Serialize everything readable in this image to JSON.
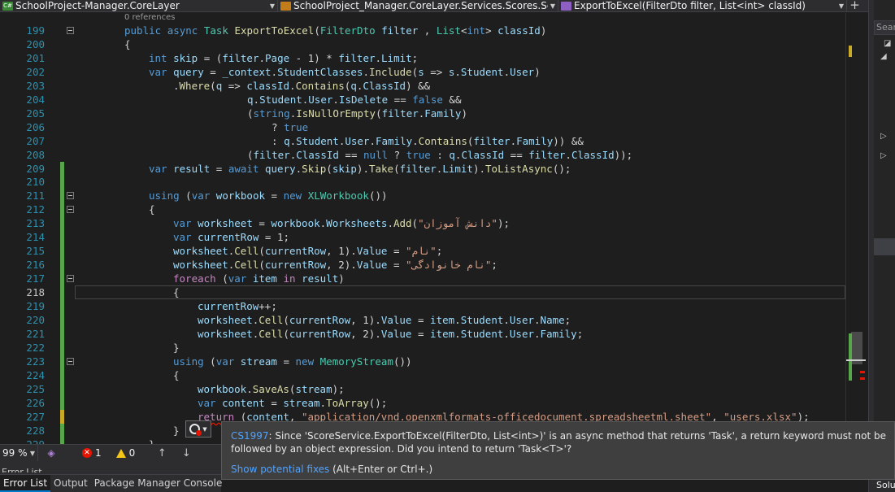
{
  "navbar": {
    "project": "SchoolProject-Manager.CoreLayer",
    "type_scope": "SchoolProject_Manager.CoreLayer.Services.Scores.ScoreServ",
    "member": "ExportToExcel(FilterDto filter, List<int> classId)",
    "project_badge": "C#",
    "add_symbol": "+"
  },
  "editor": {
    "codelens": "0 references",
    "lines": [
      {
        "n": "199",
        "seg": [
          [
            "k",
            "public "
          ],
          [
            "k",
            "async "
          ],
          [
            "t",
            "Task "
          ],
          [
            "m",
            "ExportToExcel"
          ],
          [
            "",
            "("
          ],
          [
            "t",
            "FilterDto "
          ],
          [
            "p",
            "filter"
          ],
          [
            "",
            " , "
          ],
          [
            "t",
            "List"
          ],
          [
            "",
            "<"
          ],
          [
            "k",
            "int"
          ],
          [
            "",
            "> "
          ],
          [
            "p",
            "classId"
          ],
          [
            "",
            ")"
          ]
        ]
      },
      {
        "n": "200",
        "seg": [
          [
            "",
            "{"
          ]
        ]
      },
      {
        "n": "201",
        "seg": [
          [
            "k",
            "int "
          ],
          [
            "p",
            "skip"
          ],
          [
            "",
            " = ("
          ],
          [
            "p",
            "filter"
          ],
          [
            "",
            "."
          ],
          [
            "p",
            "Page"
          ],
          [
            "",
            " - "
          ],
          [
            "",
            "1"
          ],
          [
            "",
            ") * "
          ],
          [
            "p",
            "filter"
          ],
          [
            "",
            "."
          ],
          [
            "p",
            "Limit"
          ],
          [
            "",
            ";"
          ]
        ]
      },
      {
        "n": "202",
        "seg": [
          [
            "k",
            "var "
          ],
          [
            "p",
            "query"
          ],
          [
            "",
            " = "
          ],
          [
            "p",
            "_context"
          ],
          [
            "",
            "."
          ],
          [
            "p",
            "StudentClasses"
          ],
          [
            "",
            "."
          ],
          [
            "m",
            "Include"
          ],
          [
            "",
            "("
          ],
          [
            "p",
            "s"
          ],
          [
            "",
            " => "
          ],
          [
            "p",
            "s"
          ],
          [
            "",
            "."
          ],
          [
            "p",
            "Student"
          ],
          [
            "",
            "."
          ],
          [
            "p",
            "User"
          ],
          [
            "",
            ")"
          ]
        ]
      },
      {
        "n": "203",
        "seg": [
          [
            "",
            "."
          ],
          [
            "m",
            "Where"
          ],
          [
            "",
            "("
          ],
          [
            "p",
            "q"
          ],
          [
            "",
            " => "
          ],
          [
            "p",
            "classId"
          ],
          [
            "",
            "."
          ],
          [
            "m",
            "Contains"
          ],
          [
            "",
            "("
          ],
          [
            "p",
            "q"
          ],
          [
            "",
            "."
          ],
          [
            "p",
            "ClassId"
          ],
          [
            "",
            ") &&"
          ]
        ]
      },
      {
        "n": "204",
        "seg": [
          [
            "p",
            "q"
          ],
          [
            "",
            "."
          ],
          [
            "p",
            "Student"
          ],
          [
            "",
            "."
          ],
          [
            "p",
            "User"
          ],
          [
            "",
            "."
          ],
          [
            "p",
            "IsDelete"
          ],
          [
            "",
            " == "
          ],
          [
            "k",
            "false"
          ],
          [
            "",
            " &&"
          ]
        ]
      },
      {
        "n": "205",
        "seg": [
          [
            "",
            "("
          ],
          [
            "k",
            "string"
          ],
          [
            "",
            "."
          ],
          [
            "m",
            "IsNullOrEmpty"
          ],
          [
            "",
            "("
          ],
          [
            "p",
            "filter"
          ],
          [
            "",
            "."
          ],
          [
            "p",
            "Family"
          ],
          [
            "",
            ")"
          ]
        ]
      },
      {
        "n": "206",
        "seg": [
          [
            "",
            "? "
          ],
          [
            "k",
            "true"
          ]
        ]
      },
      {
        "n": "207",
        "seg": [
          [
            "",
            ": "
          ],
          [
            "p",
            "q"
          ],
          [
            "",
            "."
          ],
          [
            "p",
            "Student"
          ],
          [
            "",
            "."
          ],
          [
            "p",
            "User"
          ],
          [
            "",
            "."
          ],
          [
            "p",
            "Family"
          ],
          [
            "",
            "."
          ],
          [
            "m",
            "Contains"
          ],
          [
            "",
            "("
          ],
          [
            "p",
            "filter"
          ],
          [
            "",
            "."
          ],
          [
            "p",
            "Family"
          ],
          [
            "",
            ")) &&"
          ]
        ]
      },
      {
        "n": "208",
        "seg": [
          [
            "",
            "("
          ],
          [
            "p",
            "filter"
          ],
          [
            "",
            "."
          ],
          [
            "p",
            "ClassId"
          ],
          [
            "",
            " == "
          ],
          [
            "k",
            "null"
          ],
          [
            "",
            " ? "
          ],
          [
            "k",
            "true"
          ],
          [
            "",
            " : "
          ],
          [
            "p",
            "q"
          ],
          [
            "",
            "."
          ],
          [
            "p",
            "ClassId"
          ],
          [
            "",
            " == "
          ],
          [
            "p",
            "filter"
          ],
          [
            "",
            "."
          ],
          [
            "p",
            "ClassId"
          ],
          [
            "",
            "));"
          ]
        ]
      },
      {
        "n": "209",
        "seg": [
          [
            "k",
            "var "
          ],
          [
            "p",
            "result"
          ],
          [
            "",
            " = "
          ],
          [
            "k",
            "await "
          ],
          [
            "p",
            "query"
          ],
          [
            "",
            "."
          ],
          [
            "m",
            "Skip"
          ],
          [
            "",
            "("
          ],
          [
            "p",
            "skip"
          ],
          [
            "",
            ")."
          ],
          [
            "m",
            "Take"
          ],
          [
            "",
            "("
          ],
          [
            "p",
            "filter"
          ],
          [
            "",
            "."
          ],
          [
            "p",
            "Limit"
          ],
          [
            "",
            ")."
          ],
          [
            "m",
            "ToListAsync"
          ],
          [
            "",
            "();"
          ]
        ]
      },
      {
        "n": "210",
        "seg": []
      },
      {
        "n": "211",
        "seg": [
          [
            "k",
            "using "
          ],
          [
            "",
            "("
          ],
          [
            "k",
            "var "
          ],
          [
            "p",
            "workbook"
          ],
          [
            "",
            " = "
          ],
          [
            "k",
            "new "
          ],
          [
            "t",
            "XLWorkbook"
          ],
          [
            "",
            "())"
          ]
        ]
      },
      {
        "n": "212",
        "seg": [
          [
            "",
            "{"
          ]
        ]
      },
      {
        "n": "213",
        "seg": [
          [
            "k",
            "var "
          ],
          [
            "p",
            "worksheet"
          ],
          [
            "",
            " = "
          ],
          [
            "p",
            "workbook"
          ],
          [
            "",
            "."
          ],
          [
            "p",
            "Worksheets"
          ],
          [
            "",
            "."
          ],
          [
            "m",
            "Add"
          ],
          [
            "",
            "("
          ],
          [
            "s",
            "\"دانش آموزان\""
          ],
          [
            "",
            ");"
          ]
        ]
      },
      {
        "n": "214",
        "seg": [
          [
            "k",
            "var "
          ],
          [
            "p",
            "currentRow"
          ],
          [
            "",
            " = "
          ],
          [
            "",
            "1"
          ],
          [
            "",
            ";"
          ]
        ]
      },
      {
        "n": "215",
        "seg": [
          [
            "p",
            "worksheet"
          ],
          [
            "",
            "."
          ],
          [
            "m",
            "Cell"
          ],
          [
            "",
            "("
          ],
          [
            "p",
            "currentRow"
          ],
          [
            "",
            ", "
          ],
          [
            "",
            "1"
          ],
          [
            "",
            ")."
          ],
          [
            "p",
            "Value"
          ],
          [
            "",
            " = "
          ],
          [
            "s",
            "\"نام\""
          ],
          [
            "",
            ";"
          ]
        ]
      },
      {
        "n": "216",
        "seg": [
          [
            "p",
            "worksheet"
          ],
          [
            "",
            "."
          ],
          [
            "m",
            "Cell"
          ],
          [
            "",
            "("
          ],
          [
            "p",
            "currentRow"
          ],
          [
            "",
            ", "
          ],
          [
            "",
            "2"
          ],
          [
            "",
            ")."
          ],
          [
            "p",
            "Value"
          ],
          [
            "",
            " = "
          ],
          [
            "s",
            "\"نام خانوادگی\""
          ],
          [
            "",
            ";"
          ]
        ]
      },
      {
        "n": "217",
        "seg": [
          [
            "c",
            "foreach "
          ],
          [
            "",
            "("
          ],
          [
            "k",
            "var "
          ],
          [
            "p",
            "item "
          ],
          [
            "c",
            "in "
          ],
          [
            "p",
            "result"
          ],
          [
            "",
            ")"
          ]
        ]
      },
      {
        "n": "218",
        "seg": [
          [
            "",
            "{"
          ]
        ]
      },
      {
        "n": "219",
        "seg": [
          [
            "p",
            "currentRow"
          ],
          [
            "",
            "++;"
          ]
        ]
      },
      {
        "n": "220",
        "seg": [
          [
            "p",
            "worksheet"
          ],
          [
            "",
            "."
          ],
          [
            "m",
            "Cell"
          ],
          [
            "",
            "("
          ],
          [
            "p",
            "currentRow"
          ],
          [
            "",
            ", "
          ],
          [
            "",
            "1"
          ],
          [
            "",
            ")."
          ],
          [
            "p",
            "Value"
          ],
          [
            "",
            " = "
          ],
          [
            "p",
            "item"
          ],
          [
            "",
            "."
          ],
          [
            "p",
            "Student"
          ],
          [
            "",
            "."
          ],
          [
            "p",
            "User"
          ],
          [
            "",
            "."
          ],
          [
            "p",
            "Name"
          ],
          [
            "",
            ";"
          ]
        ]
      },
      {
        "n": "221",
        "seg": [
          [
            "p",
            "worksheet"
          ],
          [
            "",
            "."
          ],
          [
            "m",
            "Cell"
          ],
          [
            "",
            "("
          ],
          [
            "p",
            "currentRow"
          ],
          [
            "",
            ", "
          ],
          [
            "",
            "2"
          ],
          [
            "",
            ")."
          ],
          [
            "p",
            "Value"
          ],
          [
            "",
            " = "
          ],
          [
            "p",
            "item"
          ],
          [
            "",
            "."
          ],
          [
            "p",
            "Student"
          ],
          [
            "",
            "."
          ],
          [
            "p",
            "User"
          ],
          [
            "",
            "."
          ],
          [
            "p",
            "Family"
          ],
          [
            "",
            ";"
          ]
        ]
      },
      {
        "n": "222",
        "seg": [
          [
            "",
            "}"
          ]
        ]
      },
      {
        "n": "223",
        "seg": [
          [
            "k",
            "using "
          ],
          [
            "",
            "("
          ],
          [
            "k",
            "var "
          ],
          [
            "p",
            "stream"
          ],
          [
            "",
            " = "
          ],
          [
            "k",
            "new "
          ],
          [
            "t",
            "MemoryStream"
          ],
          [
            "",
            "())"
          ]
        ]
      },
      {
        "n": "224",
        "seg": [
          [
            "",
            "{"
          ]
        ]
      },
      {
        "n": "225",
        "seg": [
          [
            "p",
            "workbook"
          ],
          [
            "",
            "."
          ],
          [
            "m",
            "SaveAs"
          ],
          [
            "",
            "("
          ],
          [
            "p",
            "stream"
          ],
          [
            "",
            ");"
          ]
        ]
      },
      {
        "n": "226",
        "seg": [
          [
            "k",
            "var "
          ],
          [
            "p",
            "content"
          ],
          [
            "",
            " = "
          ],
          [
            "p",
            "stream"
          ],
          [
            "",
            "."
          ],
          [
            "m",
            "ToArray"
          ],
          [
            "",
            "();"
          ]
        ]
      },
      {
        "n": "227",
        "seg": [
          [
            "c",
            "return "
          ],
          [
            "",
            "("
          ],
          [
            "p",
            "content"
          ],
          [
            "",
            ", "
          ],
          [
            "s",
            "\"application/vnd.openxmlformats-officedocument.spreadsheetml.sheet\""
          ],
          [
            "",
            ", "
          ],
          [
            "s",
            "\"users.xlsx\""
          ],
          [
            "",
            ");"
          ]
        ]
      },
      {
        "n": "228",
        "seg": [
          [
            "",
            "}"
          ]
        ]
      },
      {
        "n": "229",
        "seg": [
          [
            "",
            "}"
          ]
        ]
      }
    ]
  },
  "status": {
    "zoom": "99 %",
    "errors": "1",
    "warnings": "0",
    "prev": "↑",
    "next": "↓"
  },
  "bottom_tabs": [
    "Error List",
    "Output",
    "Package Manager Console"
  ],
  "partial_tab": "Error List",
  "tooltip": {
    "code": "CS1997",
    "message": ": Since 'ScoreService.ExportToExcel(FilterDto, List<int>)' is an async method that returns 'Task', a return keyword must not be followed by an object expression. Did you intend to return 'Task<T>'?",
    "fix_link": "Show potential fixes",
    "fix_shortcut": " (Alt+Enter or Ctrl+.)"
  },
  "right_panel": {
    "search": "Search",
    "solution": "Solu"
  }
}
